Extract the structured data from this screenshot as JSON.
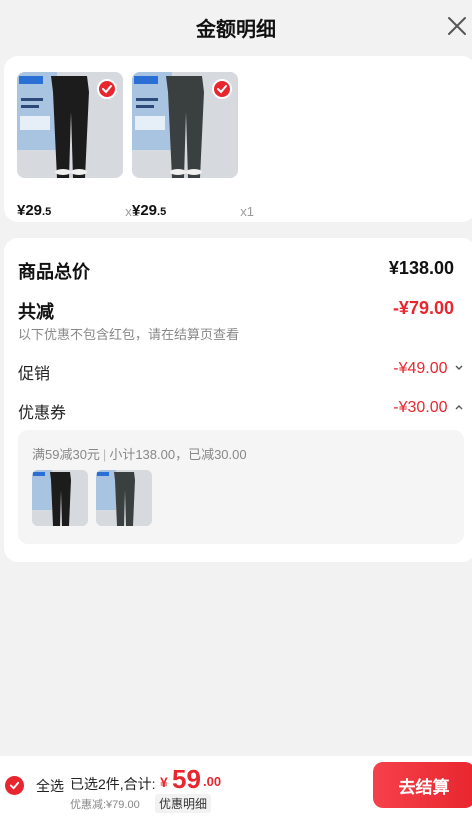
{
  "header": {
    "title": "金额明细",
    "close_icon": "close-icon"
  },
  "products": [
    {
      "price_int": "¥29",
      "price_dec": ".5",
      "qty": "x1",
      "selected": true
    },
    {
      "price_int": "¥29",
      "price_dec": ".5",
      "qty": "x1",
      "selected": true
    }
  ],
  "summary": {
    "goods_total_label": "商品总价",
    "goods_total_value": "¥138.00",
    "reduction_label": "共减",
    "reduction_value": "-¥79.00",
    "note": "以下优惠不包含红包，请在结算页查看",
    "promo_label": "促销",
    "promo_value": "-¥49.00",
    "coupon_label": "优惠券",
    "coupon_value": "-¥30.00"
  },
  "coupon_detail": {
    "rule": "满59减30元",
    "subtotal": "小计138.00，已减30.00"
  },
  "bottom_bar": {
    "select_all": "全选",
    "selected_info": "已选2件,合计:",
    "total_yen": "¥",
    "total_int": "59",
    "total_dec": ".00",
    "discount_line": "优惠减:¥79.00",
    "detail_link": "优惠明细",
    "checkout": "去结算"
  },
  "colors": {
    "accent": "#e8262e",
    "background": "#f2f2f2"
  }
}
